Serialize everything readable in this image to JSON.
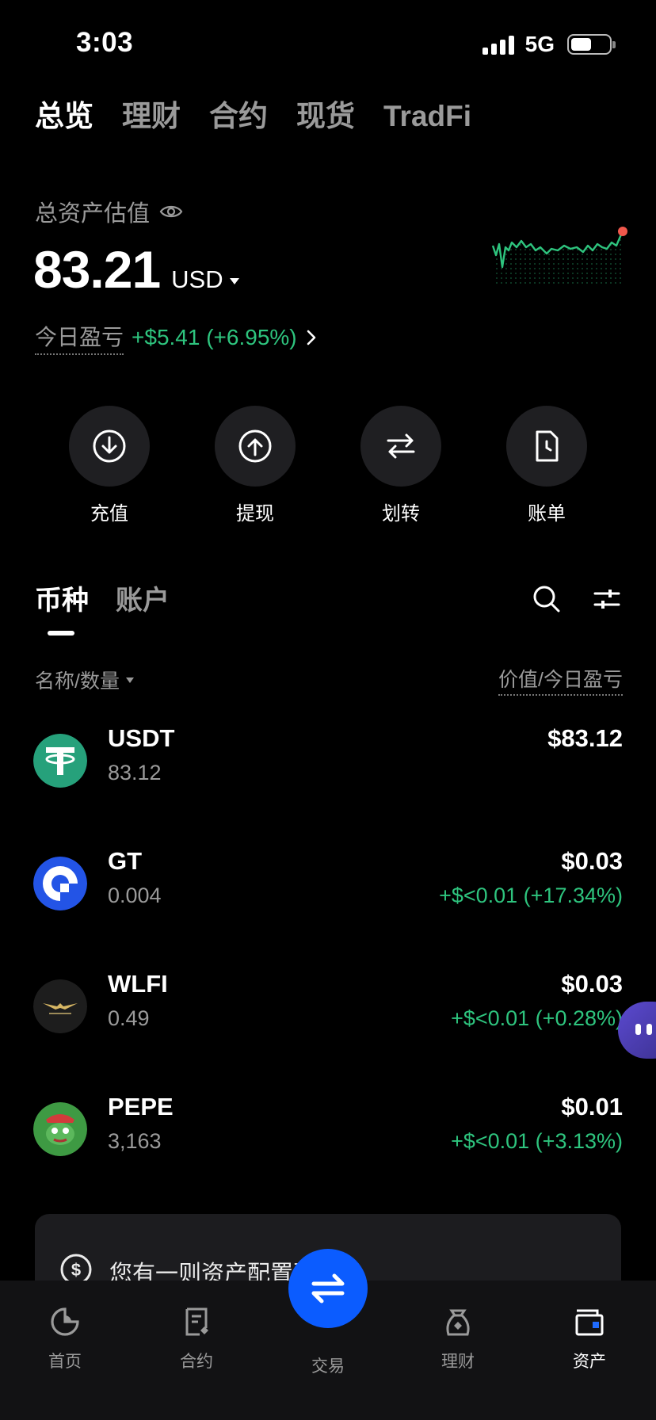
{
  "status_bar": {
    "time": "3:03",
    "network": "5G"
  },
  "top_tabs": [
    {
      "label": "总览"
    },
    {
      "label": "理财"
    },
    {
      "label": "合约"
    },
    {
      "label": "现货"
    },
    {
      "label": "TradFi"
    }
  ],
  "overview": {
    "total_label": "总资产估值",
    "total_value": "83.21",
    "currency": "USD",
    "pnl_label": "今日盈亏",
    "pnl_value": "+$5.41 (+6.95%)"
  },
  "actions": [
    {
      "label": "充值",
      "icon": "deposit-icon"
    },
    {
      "label": "提现",
      "icon": "withdraw-icon"
    },
    {
      "label": "划转",
      "icon": "transfer-icon"
    },
    {
      "label": "账单",
      "icon": "bill-icon"
    }
  ],
  "section_tabs": [
    {
      "label": "币种"
    },
    {
      "label": "账户"
    }
  ],
  "list_header": {
    "left": "名称/数量",
    "right": "价值/今日盈亏"
  },
  "coins": [
    {
      "name": "USDT",
      "qty": "83.12",
      "value": "$83.12",
      "pnl": ""
    },
    {
      "name": "GT",
      "qty": "0.004",
      "value": "$0.03",
      "pnl": "+$<0.01 (+17.34%)"
    },
    {
      "name": "WLFI",
      "qty": "0.49",
      "value": "$0.03",
      "pnl": "+$<0.01 (+0.28%)"
    },
    {
      "name": "PEPE",
      "qty": "3,163",
      "value": "$0.01",
      "pnl": "+$<0.01 (+3.13%)"
    }
  ],
  "suggestion": {
    "text": "您有一则资产配置建议"
  },
  "bottom_nav": [
    {
      "label": "首页"
    },
    {
      "label": "合约"
    },
    {
      "label": "交易"
    },
    {
      "label": "理财"
    },
    {
      "label": "资产"
    }
  ],
  "colors": {
    "positive": "#2ec47e",
    "accent": "#0b5cff",
    "background": "#000000"
  }
}
